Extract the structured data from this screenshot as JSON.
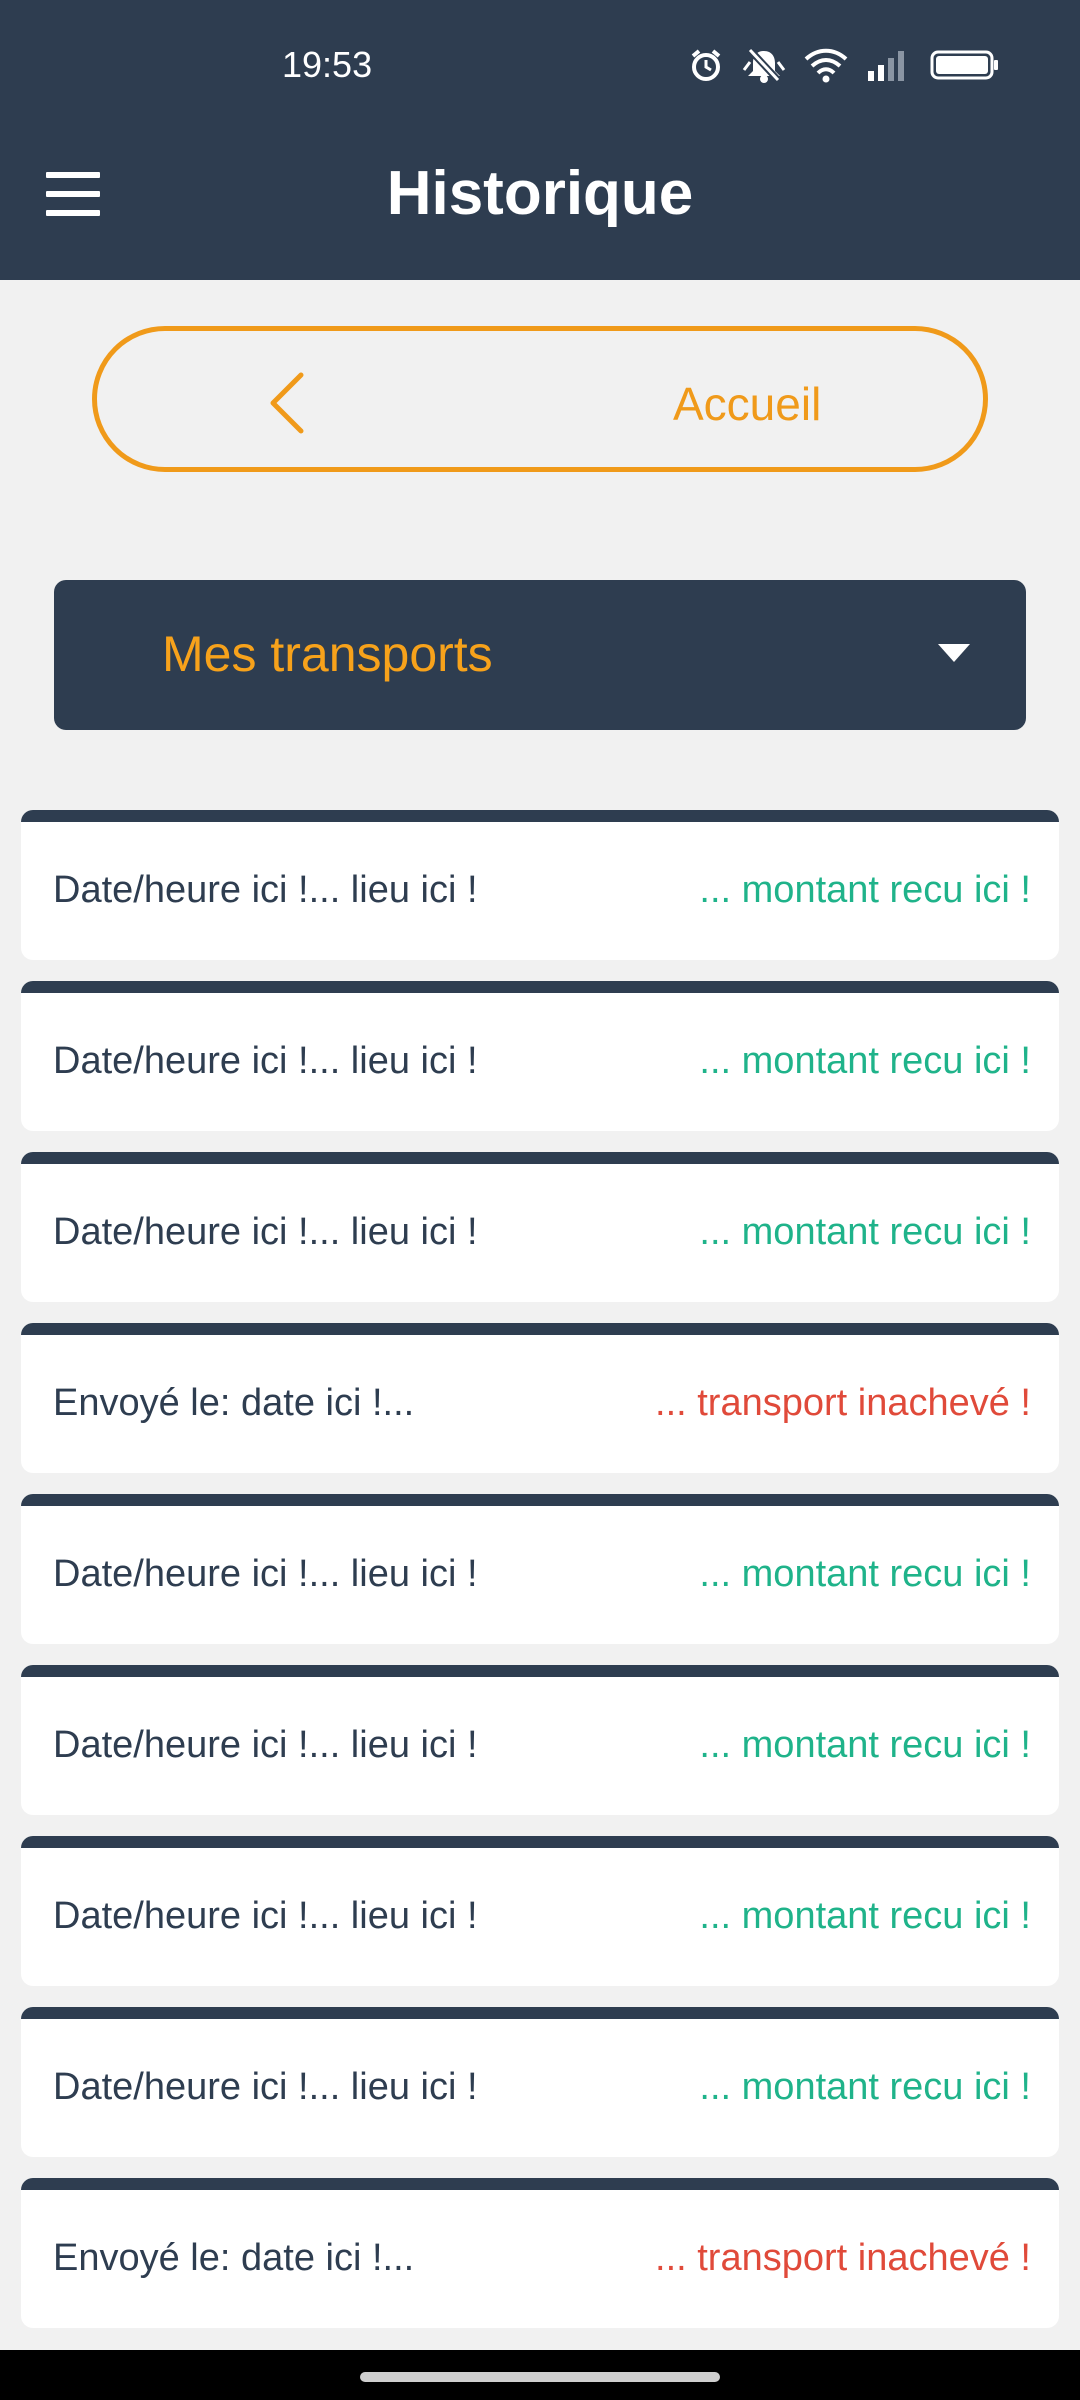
{
  "status_bar": {
    "time": "19:53",
    "icons": [
      "alarm-icon",
      "silent-bell-icon",
      "wifi-icon",
      "cellular-signal-icon",
      "battery-icon"
    ]
  },
  "header": {
    "title": "Historique",
    "menu_icon": "hamburger-menu-icon"
  },
  "home_button": {
    "label": "Accueil",
    "icon": "chevron-left-icon"
  },
  "dropdown": {
    "selected": "Mes transports",
    "icon": "caret-down-icon"
  },
  "colors": {
    "primary_dark": "#2e3d50",
    "accent_orange": "#f09a1a",
    "amount_green": "#1fb38a",
    "error_red": "#e04a3a",
    "background": "#f1f1f1"
  },
  "transports": [
    {
      "left": "Date/heure ici !... lieu ici !",
      "right": "... montant recu ici !",
      "status": "ok"
    },
    {
      "left": "Date/heure ici !... lieu ici !",
      "right": "... montant recu ici !",
      "status": "ok"
    },
    {
      "left": "Date/heure ici !... lieu ici !",
      "right": "... montant recu ici !",
      "status": "ok"
    },
    {
      "left": "Envoyé le: date ici !...",
      "right": "... transport inachevé !",
      "status": "err"
    },
    {
      "left": "Date/heure ici !... lieu ici !",
      "right": "... montant recu ici !",
      "status": "ok"
    },
    {
      "left": "Date/heure ici !... lieu ici !",
      "right": "... montant recu ici !",
      "status": "ok"
    },
    {
      "left": "Date/heure ici !... lieu ici !",
      "right": "... montant recu ici !",
      "status": "ok"
    },
    {
      "left": "Date/heure ici !... lieu ici !",
      "right": "... montant recu ici !",
      "status": "ok"
    },
    {
      "left": "Envoyé le: date ici !...",
      "right": "... transport inachevé !",
      "status": "err"
    }
  ]
}
